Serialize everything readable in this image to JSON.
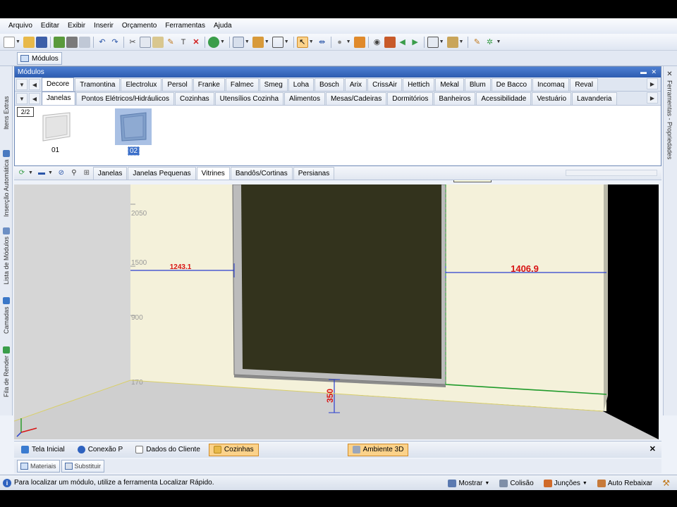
{
  "menu": [
    "Arquivo",
    "Editar",
    "Exibir",
    "Inserir",
    "Orçamento",
    "Ferramentas",
    "Ajuda"
  ],
  "toolbar_icons": [
    "new-icon",
    "open-icon",
    "save-icon",
    "print-icon",
    "undo-icon",
    "redo-icon",
    "cut-icon",
    "copy-icon",
    "paste-icon",
    "delete-icon",
    "select-icon",
    "view-icon",
    "render-icon",
    "settings-icon"
  ],
  "modules_tab": "Módulos",
  "panel": {
    "title": "Módulos",
    "title_buttons": "▬ ✕",
    "brand_tabs": [
      "Decore",
      "Tramontina",
      "Electrolux",
      "Persol",
      "Franke",
      "Falmec",
      "Smeg",
      "Loha",
      "Bosch",
      "Arix",
      "CrissAir",
      "Hettich",
      "Mekal",
      "Blum",
      "De Bacco",
      "Incomaq",
      "Reval"
    ],
    "active_brand": "Decore",
    "category_tabs": [
      "Janelas",
      "Pontos Elétricos/Hidráulicos",
      "Cozinhas",
      "Utensílios Cozinha",
      "Alimentos",
      "Mesas/Cadeiras",
      "Dormitórios",
      "Banheiros",
      "Acessibilidade",
      "Vestuário",
      "Lavanderia"
    ],
    "active_category": "Janelas",
    "page_badge": "2/2",
    "items": [
      {
        "label": "01"
      },
      {
        "label": "02"
      }
    ],
    "tooltip": "Dormitórios"
  },
  "subtabs": [
    "Janelas",
    "Janelas Pequenas",
    "Vitrines",
    "Bandôs/Cortinas",
    "Persianas"
  ],
  "active_subtab": "Vitrines",
  "left_strip": [
    "Itens Extras",
    "Inserção Automática",
    "Lista de Módulos",
    "Camadas",
    "Fila de Render"
  ],
  "right_strip": "Ferramentas - Propriedades",
  "viewport": {
    "height_marks": [
      "2050",
      "1500",
      "900",
      "170"
    ],
    "dim_left": "1243.1",
    "dim_right": "1406.9",
    "dim_vertical": "350",
    "colors": {
      "wall": "#f4f1da",
      "floor": "#cfcfcf",
      "window": "#33331d",
      "dimension": "#d81414",
      "guide": "#2a3fcf"
    }
  },
  "doc_tabs": [
    {
      "label": "Tela Inicial",
      "active": false
    },
    {
      "label": "Conexão P",
      "active": false
    },
    {
      "label": "Dados do Cliente",
      "active": false
    },
    {
      "label": "Cozinhas",
      "active": true
    },
    {
      "label": "Ambiente 3D",
      "active": true
    }
  ],
  "bottom_tabs": [
    "Materiais",
    "Substituir"
  ],
  "status": {
    "message": "Para localizar um módulo, utilize a ferramenta Localizar Rápido.",
    "mostrar": "Mostrar",
    "colisao": "Colisão",
    "juncoes": "Junções",
    "auto_rebaixar": "Auto Rebaixar"
  }
}
